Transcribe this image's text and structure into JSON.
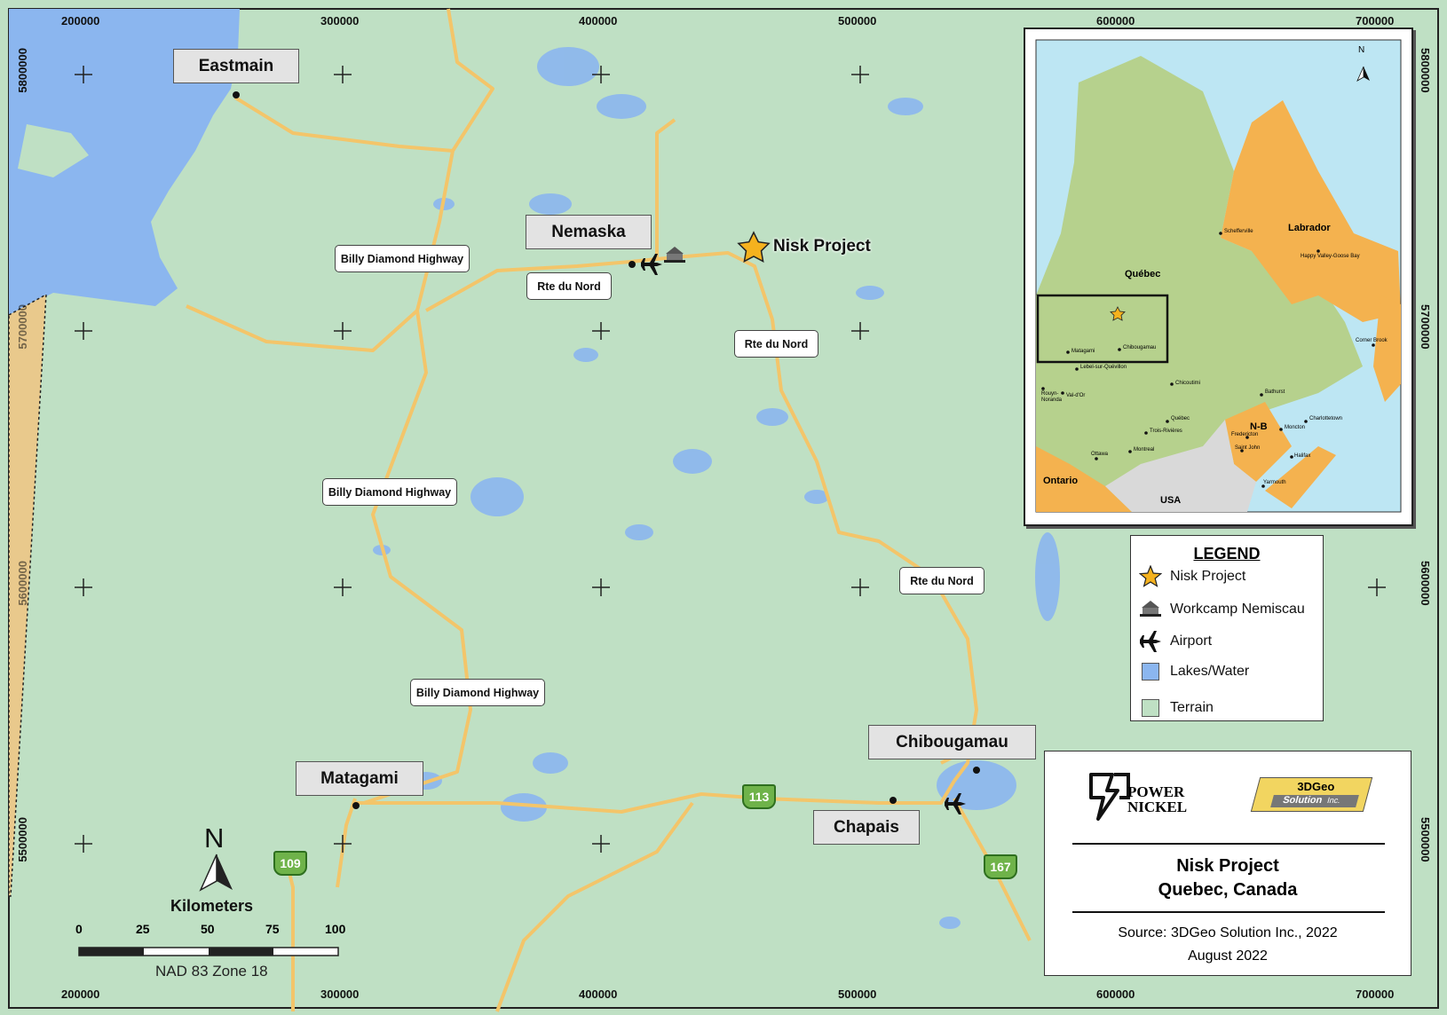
{
  "map": {
    "places": {
      "eastmain": "Eastmain",
      "nemaska": "Nemaska",
      "matagami": "Matagami",
      "chibougamau": "Chibougamau",
      "chapais": "Chapais"
    },
    "project_label": "Nisk Project",
    "roads": {
      "billy1": "Billy Diamond Highway",
      "billy2": "Billy Diamond Highway",
      "billy3": "Billy Diamond Highway",
      "nord1": "Rte du Nord",
      "nord2": "Rte du Nord",
      "nord3": "Rte du Nord"
    },
    "highways": {
      "h109": "109",
      "h113": "113",
      "h167": "167"
    },
    "easting_top": [
      "200000",
      "300000",
      "400000",
      "500000",
      "600000",
      "700000"
    ],
    "easting_bottom": [
      "200000",
      "300000",
      "400000",
      "500000",
      "600000",
      "700000"
    ],
    "northing_left": [
      "5800000",
      "5700000",
      "5600000",
      "5500000"
    ],
    "northing_right": [
      "5800000",
      "5700000",
      "5600000",
      "5500000"
    ],
    "colors": {
      "terrain": "#bfe0c4",
      "water": "#8bb6ef",
      "road": "#f3c56a",
      "star": "#f5b21e"
    }
  },
  "scale": {
    "north_letter": "N",
    "units": "Kilometers",
    "ticks": [
      "0",
      "25",
      "50",
      "75",
      "100"
    ],
    "projection": "NAD 83 Zone 18"
  },
  "legend": {
    "title": "LEGEND",
    "items": [
      {
        "icon": "star-icon",
        "label": "Nisk Project"
      },
      {
        "icon": "workcamp-icon",
        "label": "Workcamp Nemiscau"
      },
      {
        "icon": "airport-icon",
        "label": "Airport"
      },
      {
        "icon": "water-swatch",
        "label": "Lakes/Water"
      },
      {
        "icon": "terrain-swatch",
        "label": "Terrain"
      }
    ]
  },
  "title": {
    "logo_power_nickel": [
      "POWER",
      "NICKEL"
    ],
    "logo_3dgeo": [
      "3DGeo",
      "Solution",
      "Inc."
    ],
    "line1": "Nisk Project",
    "line2": "Quebec, Canada",
    "source": "Source: 3DGeo Solution Inc., 2022",
    "date": "August 2022"
  },
  "inset": {
    "north_letter": "N",
    "regions": {
      "quebec": "Québec",
      "labrador": "Labrador",
      "ontario": "Ontario",
      "nb": "N-B",
      "usa": "USA"
    },
    "towns": [
      "Schefferville",
      "Happy Valley-Goose Bay",
      "Matagami",
      "Chibougamau",
      "Lebel-sur-Quévillon",
      "Chicoutimi",
      "Rouyn-Noranda",
      "Val-d'Or",
      "Québec",
      "Trois-Rivières",
      "Montreal",
      "Ottawa",
      "Bathurst",
      "Fredericton",
      "Moncton",
      "Charlottetown",
      "Saint John",
      "Halifax",
      "Yarmouth",
      "Corner Brook"
    ]
  }
}
